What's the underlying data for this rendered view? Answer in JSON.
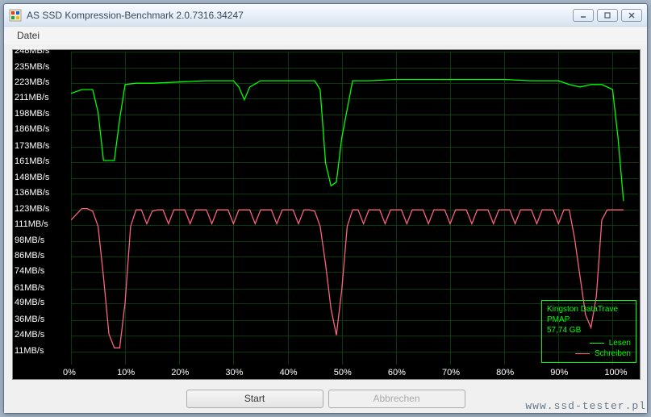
{
  "window": {
    "title": "AS SSD Kompression-Benchmark 2.0.7316.34247"
  },
  "menu": {
    "datei": "Datei"
  },
  "buttons": {
    "start": "Start",
    "abort": "Abbrechen"
  },
  "legend": {
    "device": "Kingston DataTrave",
    "firmware": "PMAP",
    "capacity": "57,74 GB",
    "read": "Lesen",
    "write": "Schreiben"
  },
  "watermark": "www.ssd-tester.pl",
  "chart_data": {
    "type": "line",
    "xlabel": "",
    "ylabel": "",
    "xlim": [
      0,
      105
    ],
    "ylim": [
      11,
      248
    ],
    "x_ticks": [
      "0%",
      "10%",
      "20%",
      "30%",
      "40%",
      "50%",
      "60%",
      "70%",
      "80%",
      "90%",
      "100%"
    ],
    "y_ticks": [
      "248MB/s",
      "235MB/s",
      "223MB/s",
      "211MB/s",
      "198MB/s",
      "186MB/s",
      "173MB/s",
      "161MB/s",
      "148MB/s",
      "136MB/s",
      "123MB/s",
      "111MB/s",
      "98MB/s",
      "86MB/s",
      "74MB/s",
      "61MB/s",
      "49MB/s",
      "36MB/s",
      "24MB/s",
      "11MB/s"
    ],
    "series": [
      {
        "name": "Lesen",
        "color": "#00ff00",
        "x": [
          0,
          2,
          3,
          4,
          5,
          6,
          7,
          8,
          9,
          10,
          12,
          15,
          20,
          25,
          28,
          30,
          31,
          32,
          33,
          35,
          40,
          44,
          45,
          46,
          47,
          48,
          49,
          50,
          52,
          55,
          60,
          65,
          70,
          75,
          80,
          85,
          90,
          92,
          94,
          96,
          98,
          99,
          100,
          101,
          102
        ],
        "values": [
          215,
          218,
          218,
          218,
          200,
          162,
          162,
          162,
          195,
          222,
          223,
          223,
          224,
          225,
          225,
          225,
          220,
          210,
          220,
          225,
          225,
          225,
          225,
          218,
          160,
          142,
          145,
          180,
          225,
          225,
          226,
          226,
          226,
          226,
          226,
          225,
          225,
          222,
          220,
          222,
          222,
          220,
          218,
          180,
          130
        ]
      },
      {
        "name": "Schreiben",
        "color": "#ff6080",
        "x": [
          0,
          2,
          3,
          4,
          5,
          6,
          7,
          8,
          9,
          10,
          11,
          12,
          13,
          14,
          15,
          16,
          17,
          18,
          19,
          20,
          21,
          22,
          23,
          24,
          25,
          26,
          27,
          28,
          29,
          30,
          31,
          32,
          33,
          34,
          35,
          36,
          37,
          38,
          39,
          40,
          41,
          42,
          43,
          44,
          45,
          46,
          47,
          48,
          49,
          50,
          51,
          52,
          53,
          54,
          55,
          56,
          57,
          58,
          59,
          60,
          61,
          62,
          63,
          64,
          65,
          66,
          67,
          68,
          69,
          70,
          71,
          72,
          73,
          74,
          75,
          76,
          77,
          78,
          79,
          80,
          81,
          82,
          83,
          84,
          85,
          86,
          87,
          88,
          89,
          90,
          91,
          92,
          93,
          94,
          95,
          96,
          97,
          98,
          99,
          100,
          101,
          102
        ],
        "values": [
          115,
          124,
          124,
          122,
          110,
          70,
          25,
          14,
          14,
          50,
          110,
          123,
          123,
          112,
          122,
          123,
          123,
          112,
          123,
          123,
          123,
          112,
          123,
          123,
          123,
          112,
          123,
          123,
          123,
          112,
          123,
          123,
          123,
          112,
          123,
          123,
          123,
          112,
          123,
          123,
          123,
          112,
          123,
          123,
          122,
          110,
          80,
          45,
          24,
          60,
          110,
          123,
          123,
          112,
          123,
          123,
          123,
          112,
          123,
          123,
          123,
          112,
          123,
          123,
          123,
          112,
          123,
          123,
          123,
          112,
          123,
          123,
          123,
          112,
          123,
          123,
          123,
          112,
          123,
          123,
          123,
          112,
          123,
          123,
          123,
          112,
          123,
          123,
          123,
          112,
          123,
          123,
          100,
          70,
          40,
          30,
          55,
          115,
          123,
          123,
          123,
          123
        ]
      }
    ]
  }
}
